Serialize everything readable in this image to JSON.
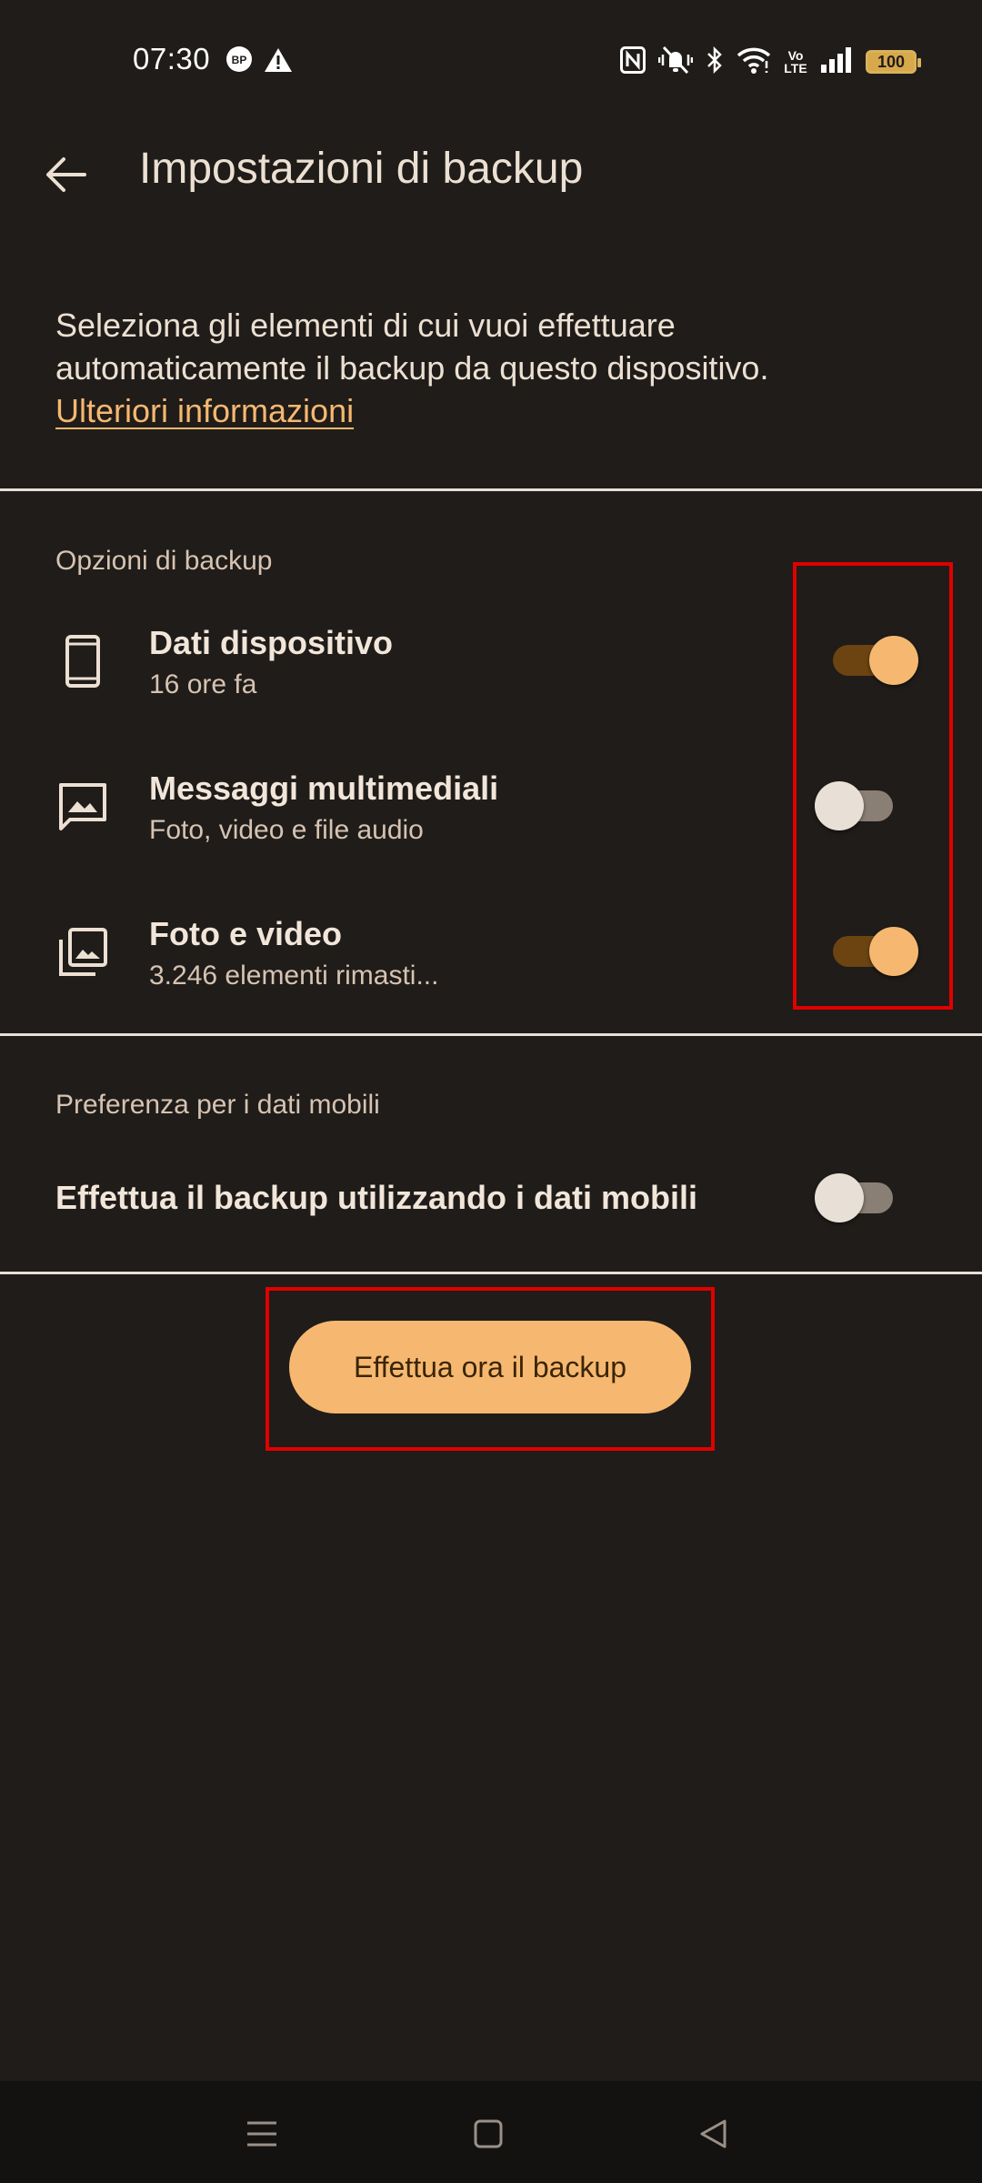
{
  "status_bar": {
    "time": "07:30",
    "left_icons": [
      "bp-notification-icon",
      "warning-icon"
    ],
    "right_icons": [
      "nfc-icon",
      "mute-vibrate-icon",
      "bluetooth-icon",
      "wifi-icon",
      "volte-icon",
      "cell-signal-icon",
      "battery-icon"
    ],
    "battery_level": "100",
    "volte_text": "Vo LTE"
  },
  "app_bar": {
    "title": "Impostazioni di backup",
    "back_icon": "arrow-back-icon"
  },
  "description": {
    "text": "Seleziona gli elementi di cui vuoi effettuare automaticamente il backup da questo dispositivo.",
    "link": "Ulteriori informazioni"
  },
  "backup_options": {
    "header": "Opzioni di backup",
    "items": [
      {
        "title": "Dati dispositivo",
        "subtitle": "16 ore fa",
        "icon": "smartphone-icon",
        "enabled": true
      },
      {
        "title": "Messaggi multimediali",
        "subtitle": "Foto, video e file audio",
        "icon": "mms-image-icon",
        "enabled": false
      },
      {
        "title": "Foto e video",
        "subtitle": "3.246 elementi rimasti...",
        "icon": "photo-library-icon",
        "enabled": true
      }
    ]
  },
  "mobile_data": {
    "header": "Preferenza per i dati mobili",
    "label": "Effettua il backup utilizzando i dati mobili",
    "enabled": false
  },
  "backup_button": {
    "label": "Effettua ora il backup"
  },
  "nav_bar": {
    "icons": [
      "menu-icon",
      "home-icon",
      "back-icon"
    ]
  },
  "colors": {
    "background": "#1f1c19",
    "accent": "#f6b870",
    "toggle_track_on": "#6b4412",
    "toggle_track_off": "#8a7f75",
    "highlight": "#e00000"
  }
}
